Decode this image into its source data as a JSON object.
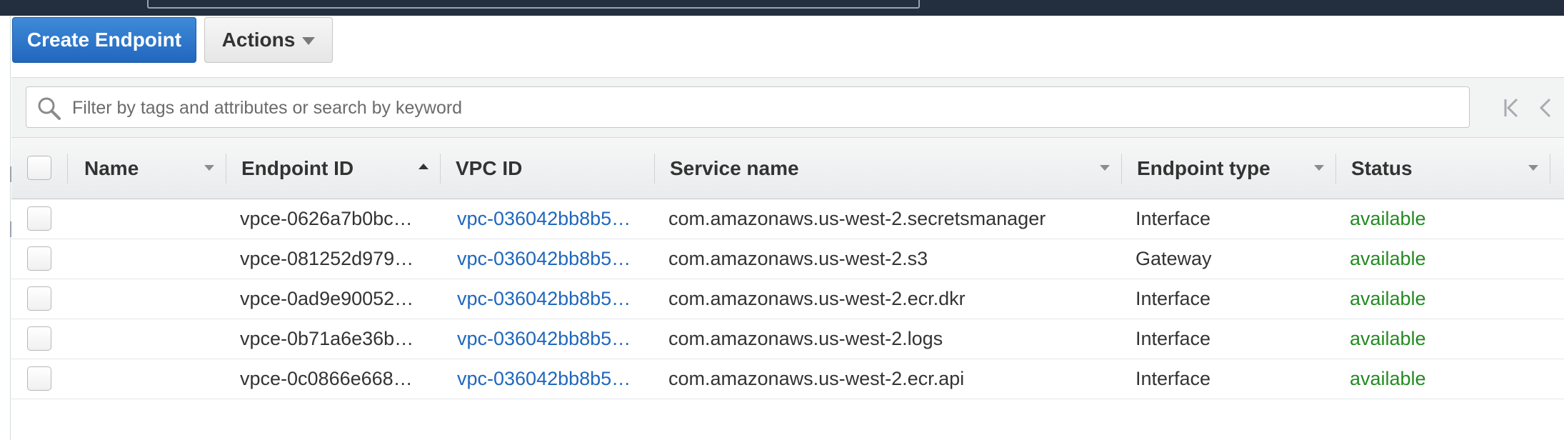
{
  "toolbar": {
    "create_label": "Create Endpoint",
    "actions_label": "Actions"
  },
  "search": {
    "placeholder": "Filter by tags and attributes or search by keyword"
  },
  "table": {
    "columns": {
      "name": "Name",
      "endpoint_id": "Endpoint ID",
      "vpc_id": "VPC ID",
      "service_name": "Service name",
      "endpoint_type": "Endpoint type",
      "status": "Status"
    },
    "rows": [
      {
        "name": "",
        "endpoint_id": "vpce-0626a7b0bc…",
        "vpc_id": "vpc-036042bb8b5…",
        "service_name": "com.amazonaws.us-west-2.secretsmanager",
        "endpoint_type": "Interface",
        "status": "available"
      },
      {
        "name": "",
        "endpoint_id": "vpce-081252d979…",
        "vpc_id": "vpc-036042bb8b5…",
        "service_name": "com.amazonaws.us-west-2.s3",
        "endpoint_type": "Gateway",
        "status": "available"
      },
      {
        "name": "",
        "endpoint_id": "vpce-0ad9e90052…",
        "vpc_id": "vpc-036042bb8b5…",
        "service_name": "com.amazonaws.us-west-2.ecr.dkr",
        "endpoint_type": "Interface",
        "status": "available"
      },
      {
        "name": "",
        "endpoint_id": "vpce-0b71a6e36b…",
        "vpc_id": "vpc-036042bb8b5…",
        "service_name": "com.amazonaws.us-west-2.logs",
        "endpoint_type": "Interface",
        "status": "available"
      },
      {
        "name": "",
        "endpoint_id": "vpce-0c0866e668…",
        "vpc_id": "vpc-036042bb8b5…",
        "service_name": "com.amazonaws.us-west-2.ecr.api",
        "endpoint_type": "Interface",
        "status": "available"
      }
    ]
  },
  "icons": {
    "search": "search-icon",
    "first_page": "first-page-icon",
    "prev_page": "prev-page-icon",
    "actions_dropdown": "chevron-down-icon"
  },
  "colors": {
    "primary": "#2067be",
    "link": "#1e67bd",
    "status_available": "#238b22",
    "topbar": "#232f3e"
  }
}
